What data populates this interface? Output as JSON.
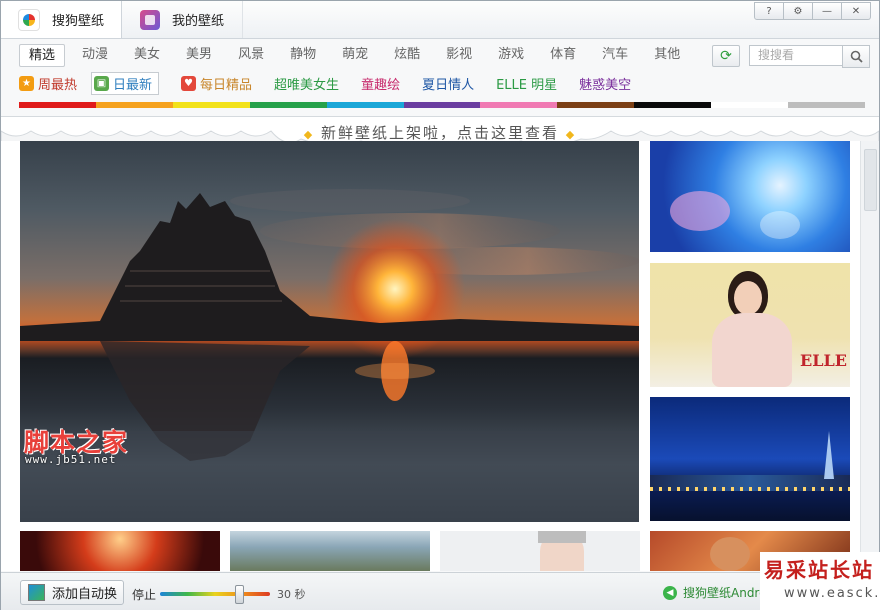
{
  "tabs": [
    {
      "label": "搜狗壁纸",
      "icon": "sogou-logo-icon",
      "active": true
    },
    {
      "label": "我的壁纸",
      "icon": "my-wallpaper-icon",
      "active": false
    }
  ],
  "window_buttons": [
    {
      "label": "?",
      "icon": "help-icon"
    },
    {
      "label": "⚙",
      "icon": "settings-icon"
    },
    {
      "label": "—",
      "icon": "minimize-icon"
    },
    {
      "label": "✕",
      "icon": "close-icon"
    }
  ],
  "categories": [
    "精选",
    "动漫",
    "美女",
    "美男",
    "风景",
    "静物",
    "萌宠",
    "炫酷",
    "影视",
    "游戏",
    "体育",
    "汽车",
    "其他"
  ],
  "active_category": "精选",
  "search": {
    "placeholder": "搜搜看"
  },
  "subnav": [
    {
      "label": "周最热",
      "icon": "star-icon",
      "color": "#c0392b",
      "icon_bg": "#f39c12"
    },
    {
      "label": "日最新",
      "icon": "picture-icon",
      "color": "#2f7fbf",
      "icon_bg": "#58a84b"
    },
    {
      "label": "每日精品",
      "icon": "heart-icon",
      "color": "#c8862b",
      "icon_bg": "#e3483b"
    },
    {
      "label": "超唯美女生",
      "icon": "",
      "color": "#2b9a44"
    },
    {
      "label": "童趣绘",
      "icon": "",
      "color": "#c72a6c"
    },
    {
      "label": "夏日情人",
      "icon": "",
      "color": "#1f57a5"
    },
    {
      "label": "ELLE 明星",
      "icon": "",
      "color": "#2b9a44"
    },
    {
      "label": "魅惑美空",
      "icon": "",
      "color": "#7a2f9c"
    }
  ],
  "color_strip": [
    "#e01b1b",
    "#f5a21e",
    "#f2e21b",
    "#26a14a",
    "#1ba7d8",
    "#6a3da0",
    "#f07ab3",
    "#7b3f15",
    "#0a0a0a",
    "#ffffff",
    "#bdbdbd"
  ],
  "banner": {
    "text": "新鲜壁纸上架啦，点击这里查看"
  },
  "watermark": {
    "title": "脚本之家",
    "url": "www.jb51.net",
    "site": "易采站长站",
    "site_url": "www.easck.com"
  },
  "bottom": {
    "auto_switch_label": "添加自动换",
    "stop_label": "停止",
    "interval_seconds": 30,
    "interval_label": "30 秒",
    "slider_fraction": 0.72,
    "android_label": "搜狗壁纸Android"
  }
}
